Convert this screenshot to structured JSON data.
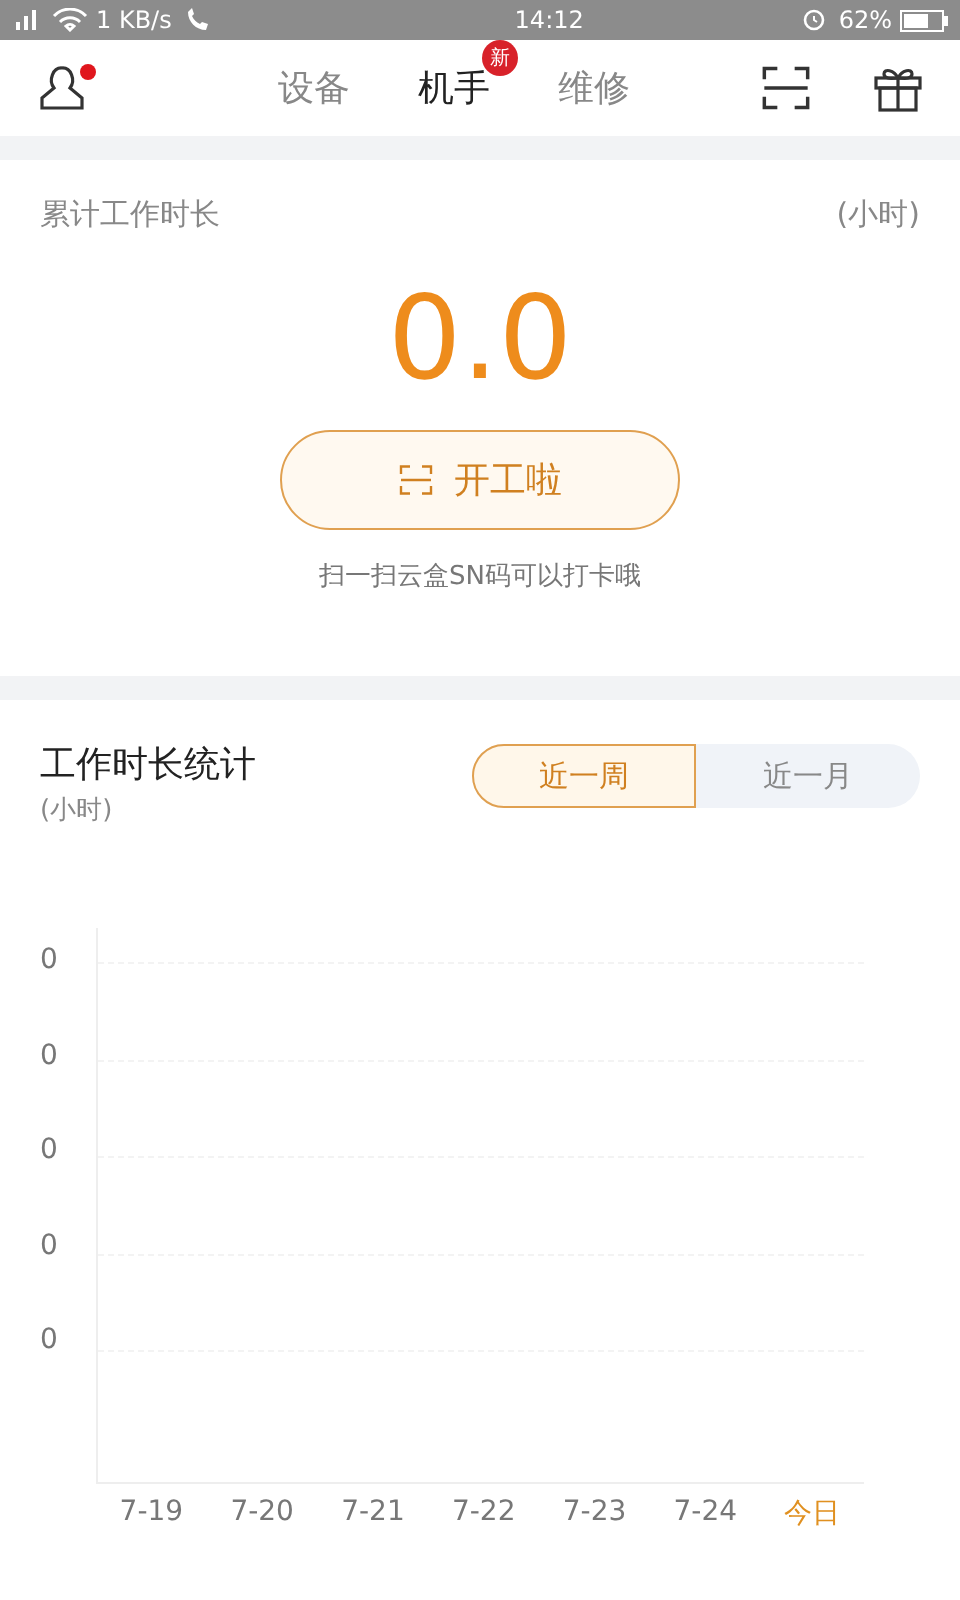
{
  "status_bar": {
    "speed": "1 KB/s",
    "time": "14:12",
    "battery": "62%"
  },
  "header": {
    "has_notification": true,
    "tabs": [
      {
        "label": "设备",
        "selected": false
      },
      {
        "label": "机手",
        "selected": true,
        "badge": "新"
      },
      {
        "label": "维修",
        "selected": false
      }
    ]
  },
  "total_card": {
    "title": "累计工作时长",
    "unit": "(小时)",
    "value": "0.0",
    "button": "开工啦",
    "hint": "扫一扫云盒SN码可以打卡哦"
  },
  "stats": {
    "title": "工作时长统计",
    "unit": "(小时)",
    "ranges": [
      {
        "label": "近一周",
        "selected": true
      },
      {
        "label": "近一月",
        "selected": false
      }
    ],
    "y_labels": [
      "0",
      "0",
      "0",
      "0",
      "0"
    ],
    "x_labels": [
      {
        "label": "7-19",
        "today": false
      },
      {
        "label": "7-20",
        "today": false
      },
      {
        "label": "7-21",
        "today": false
      },
      {
        "label": "7-22",
        "today": false
      },
      {
        "label": "7-23",
        "today": false
      },
      {
        "label": "7-24",
        "today": false
      },
      {
        "label": "今日",
        "today": true
      }
    ]
  }
}
